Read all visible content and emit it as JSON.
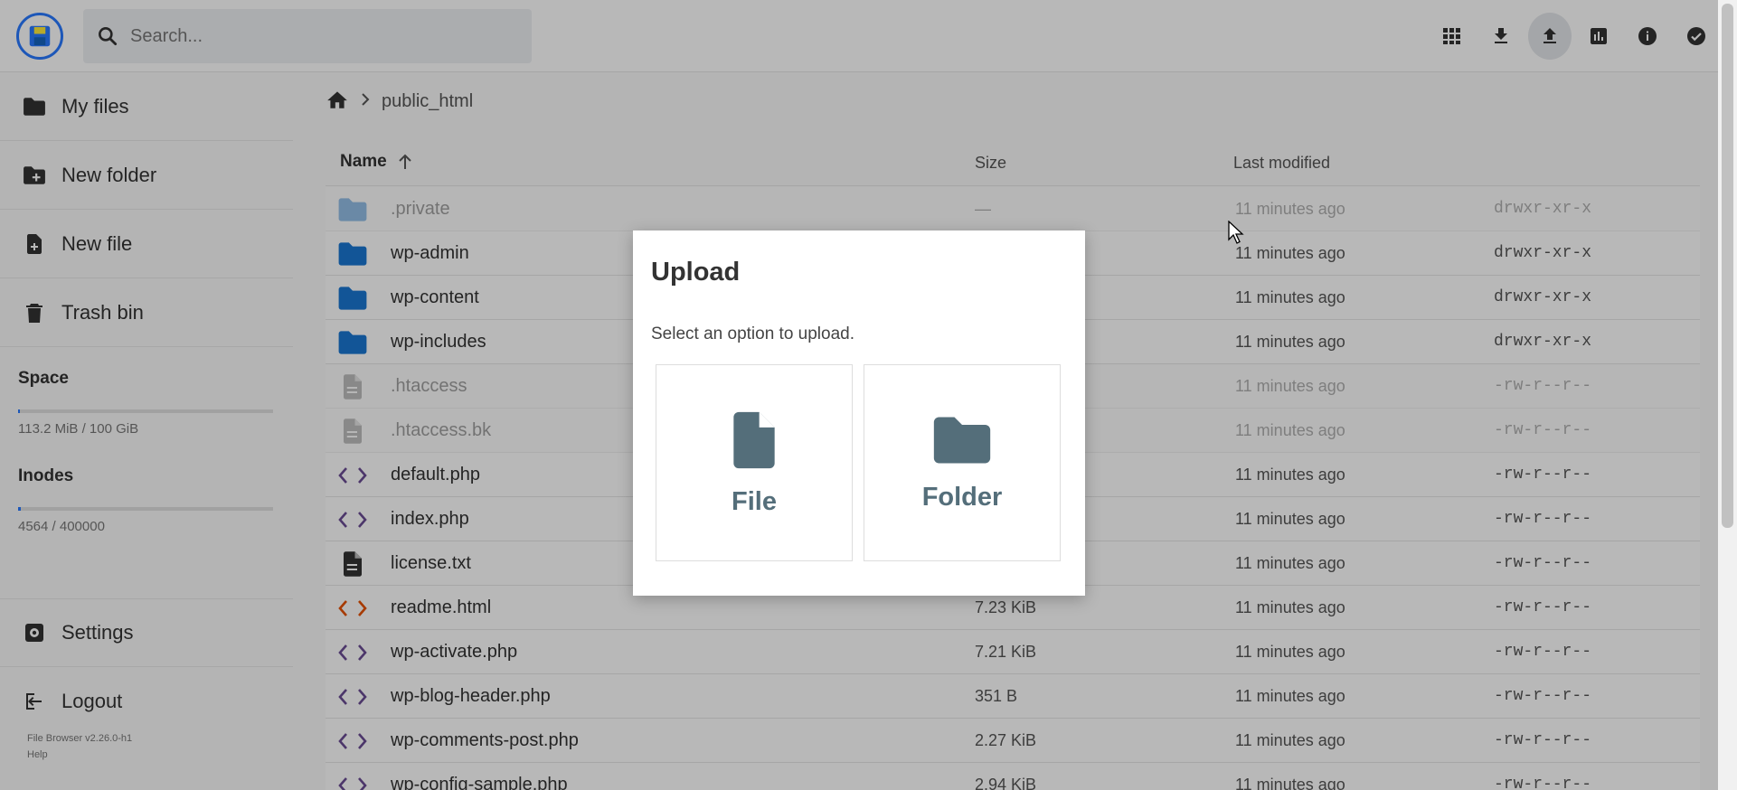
{
  "search": {
    "placeholder": "Search..."
  },
  "header": {
    "actions": [
      "grid-view-icon",
      "download-icon",
      "upload-icon",
      "chart-icon",
      "info-icon",
      "check-circle-icon"
    ]
  },
  "sidebar": {
    "items": [
      {
        "label": "My files",
        "icon": "folder-icon"
      },
      {
        "label": "New folder",
        "icon": "folder-plus-icon"
      },
      {
        "label": "New file",
        "icon": "file-plus-icon"
      },
      {
        "label": "Trash bin",
        "icon": "trash-icon"
      }
    ],
    "space": {
      "title": "Space",
      "text": "113.2 MiB / 100 GiB",
      "fraction": 0.001
    },
    "inodes": {
      "title": "Inodes",
      "text": "4564 / 400000",
      "fraction": 0.011
    },
    "settings": "Settings",
    "logout": "Logout",
    "credits": {
      "version": "File Browser v2.26.0-h1",
      "help": "Help"
    }
  },
  "breadcrumb": {
    "current": "public_html"
  },
  "table": {
    "headers": {
      "name": "Name",
      "size": "Size",
      "modified": "Last modified"
    },
    "rows": [
      {
        "name": ".private",
        "size": "—",
        "modified": "11 minutes ago",
        "perm": "drwxr-xr-x",
        "type": "folder",
        "dim": true
      },
      {
        "name": "wp-admin",
        "size": "",
        "modified": "11 minutes ago",
        "perm": "drwxr-xr-x",
        "type": "folder",
        "dim": false
      },
      {
        "name": "wp-content",
        "size": "",
        "modified": "11 minutes ago",
        "perm": "drwxr-xr-x",
        "type": "folder",
        "dim": false
      },
      {
        "name": "wp-includes",
        "size": "",
        "modified": "11 minutes ago",
        "perm": "drwxr-xr-x",
        "type": "folder",
        "dim": false
      },
      {
        "name": ".htaccess",
        "size": "",
        "modified": "11 minutes ago",
        "perm": "-rw-r--r--",
        "type": "file",
        "dim": true
      },
      {
        "name": ".htaccess.bk",
        "size": "",
        "modified": "11 minutes ago",
        "perm": "-rw-r--r--",
        "type": "file",
        "dim": true
      },
      {
        "name": "default.php",
        "size": "",
        "modified": "11 minutes ago",
        "perm": "-rw-r--r--",
        "type": "code",
        "dim": false
      },
      {
        "name": "index.php",
        "size": "",
        "modified": "11 minutes ago",
        "perm": "-rw-r--r--",
        "type": "code",
        "dim": false
      },
      {
        "name": "license.txt",
        "size": "",
        "modified": "11 minutes ago",
        "perm": "-rw-r--r--",
        "type": "text",
        "dim": false
      },
      {
        "name": "readme.html",
        "size": "7.23 KiB",
        "modified": "11 minutes ago",
        "perm": "-rw-r--r--",
        "type": "html",
        "dim": false
      },
      {
        "name": "wp-activate.php",
        "size": "7.21 KiB",
        "modified": "11 minutes ago",
        "perm": "-rw-r--r--",
        "type": "code",
        "dim": false
      },
      {
        "name": "wp-blog-header.php",
        "size": "351 B",
        "modified": "11 minutes ago",
        "perm": "-rw-r--r--",
        "type": "code",
        "dim": false
      },
      {
        "name": "wp-comments-post.php",
        "size": "2.27 KiB",
        "modified": "11 minutes ago",
        "perm": "-rw-r--r--",
        "type": "code",
        "dim": false
      },
      {
        "name": "wp-config-sample.php",
        "size": "2.94 KiB",
        "modified": "11 minutes ago",
        "perm": "-rw-r--r--",
        "type": "code",
        "dim": false
      }
    ]
  },
  "modal": {
    "title": "Upload",
    "text": "Select an option to upload.",
    "file_label": "File",
    "folder_label": "Folder"
  },
  "colors": {
    "accent": "#2979ff",
    "folder": "#1976d2",
    "option_icon": "#546e7a",
    "html_icon": "#e65100",
    "code_icon": "#6a4c93"
  }
}
